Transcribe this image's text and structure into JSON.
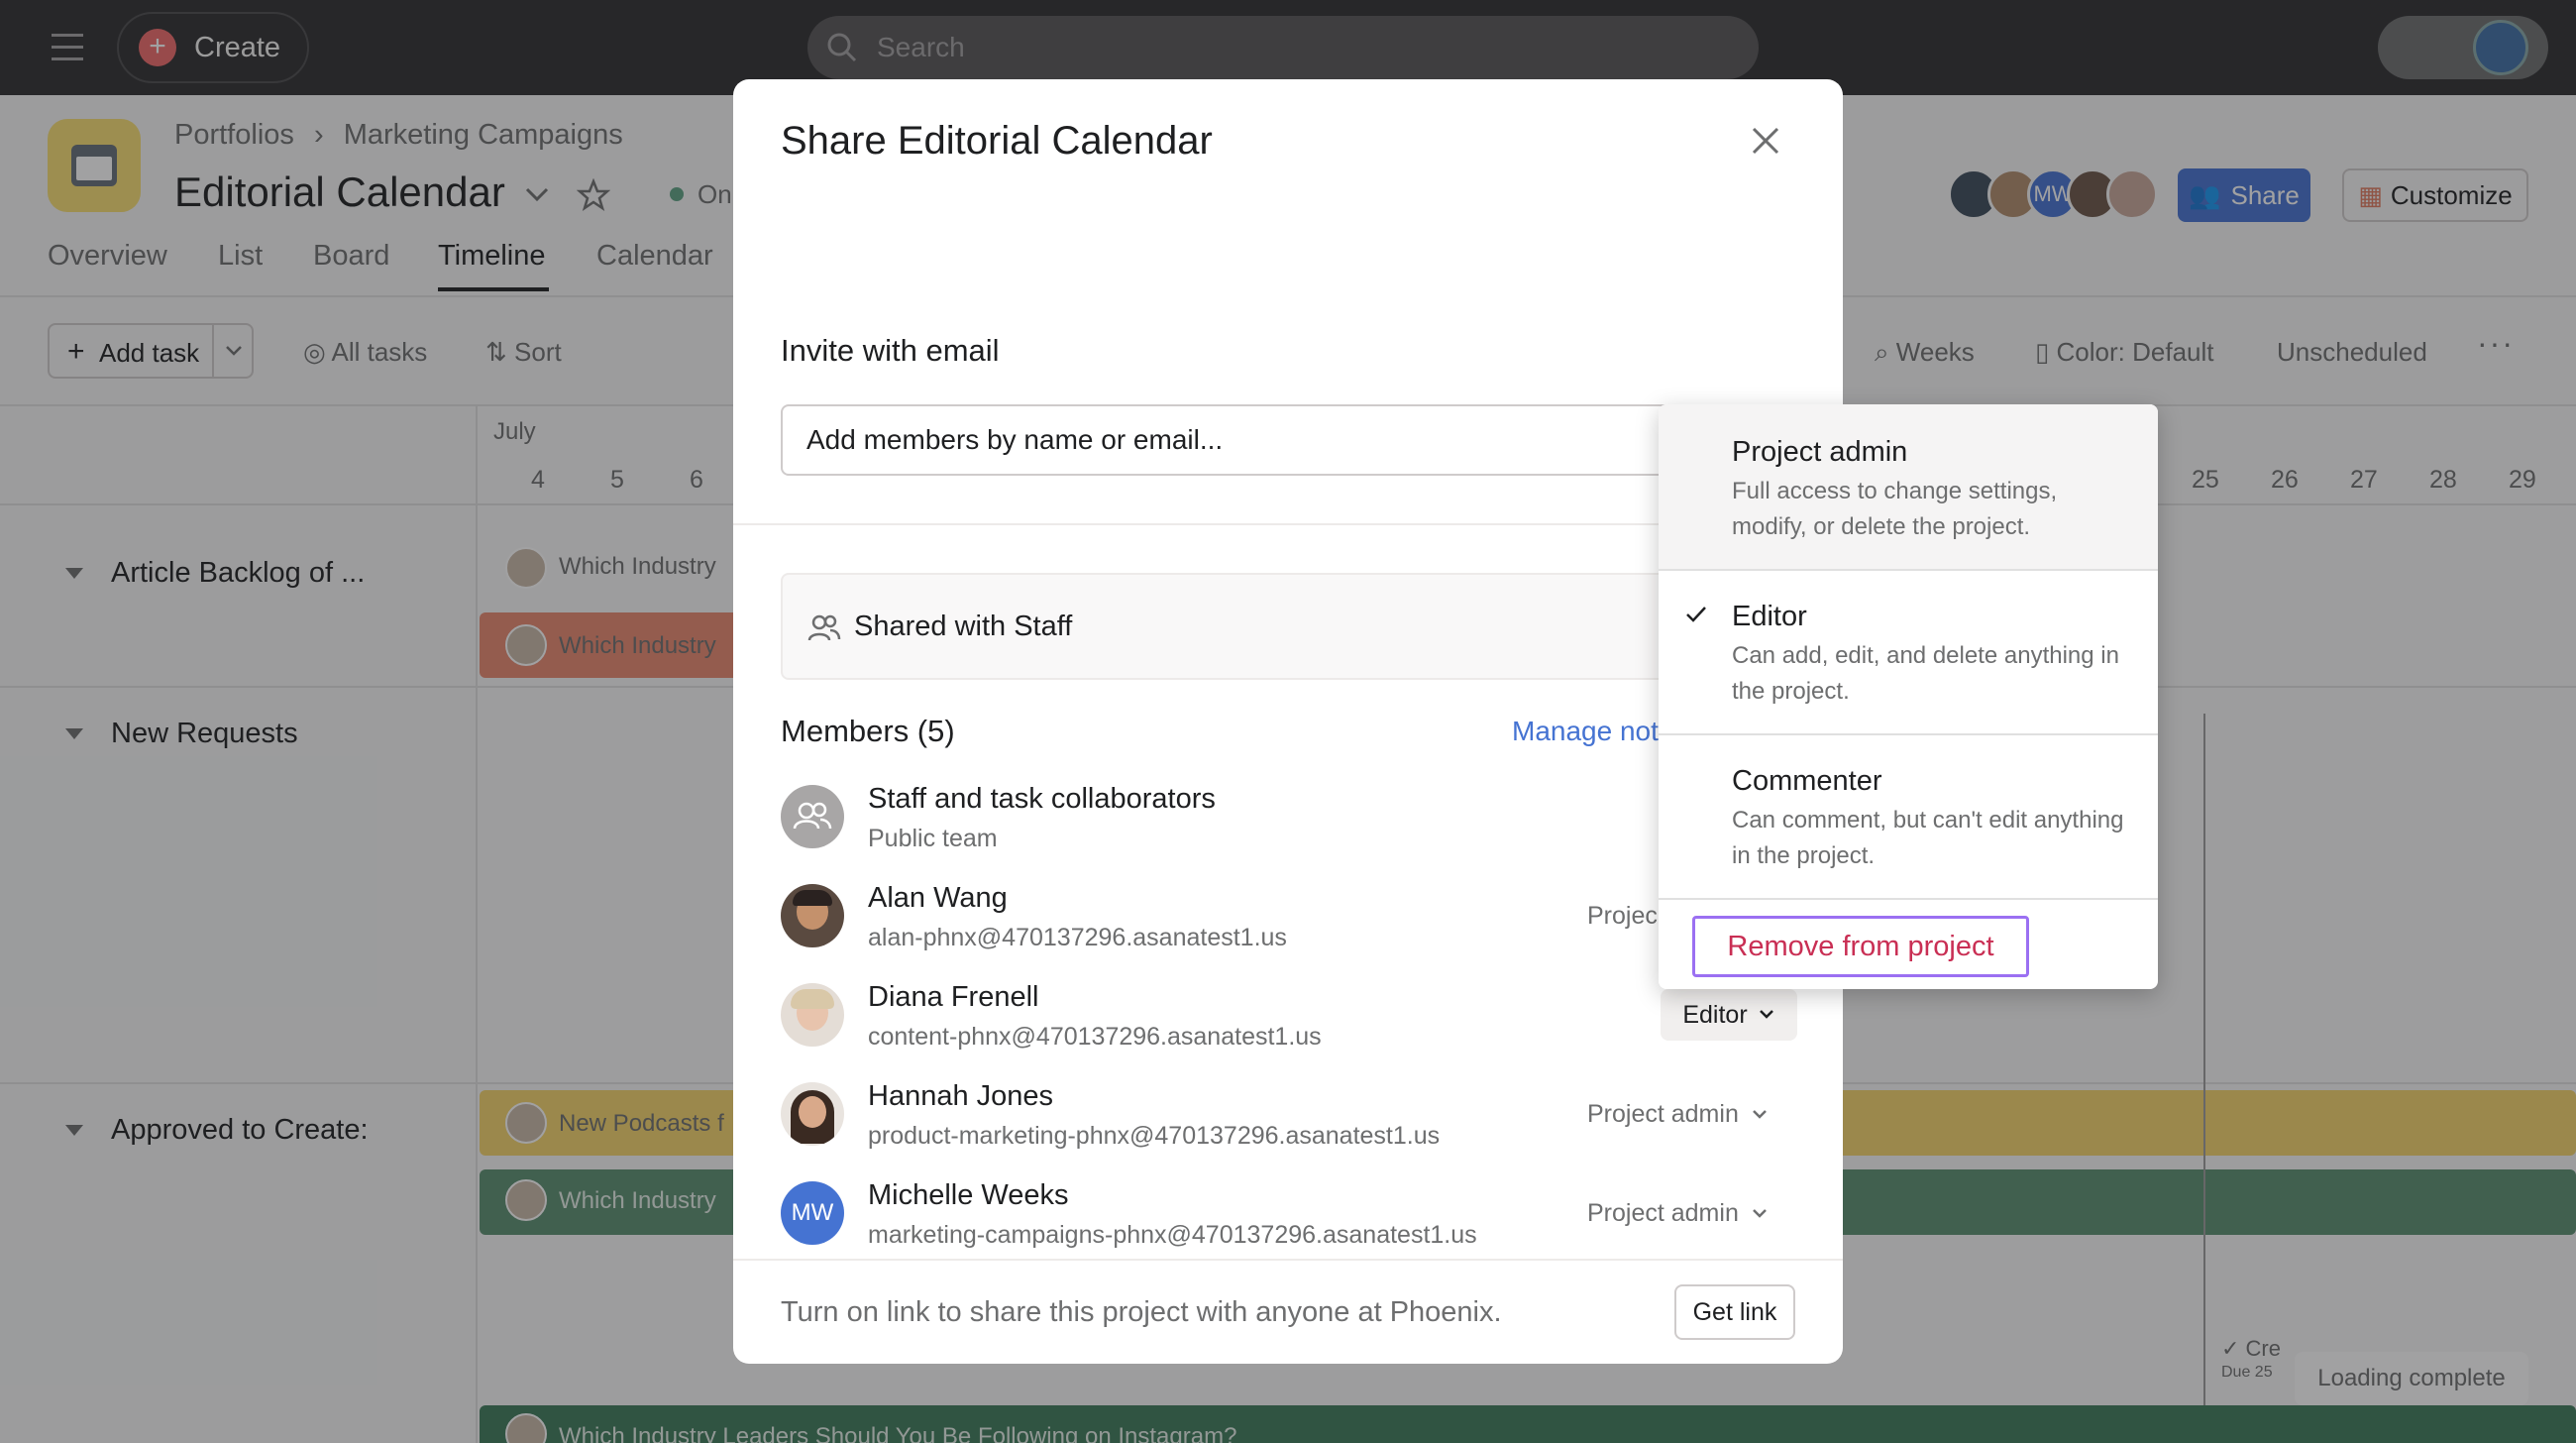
{
  "topbar": {
    "create_label": "Create",
    "search_placeholder": "Search"
  },
  "project": {
    "breadcrumb_parent": "Portfolios",
    "breadcrumb_child": "Marketing Campaigns",
    "title": "Editorial Calendar",
    "status": "On"
  },
  "tabs": [
    "Overview",
    "List",
    "Board",
    "Timeline",
    "Calendar"
  ],
  "active_tab": "Timeline",
  "header_actions": {
    "avatar_initials": "MW",
    "share_label": "Share",
    "customize_label": "Customize"
  },
  "toolbar": {
    "add_task_label": "Add task",
    "all_tasks_label": "All tasks",
    "sort_label": "Sort",
    "weeks_label": "Weeks",
    "color_label": "Color: Default",
    "unscheduled_label": "Unscheduled"
  },
  "timeline": {
    "month": "July",
    "days_left": [
      "4",
      "5",
      "6"
    ],
    "days_right": [
      "25",
      "26",
      "27",
      "28",
      "29"
    ],
    "sections": [
      {
        "title": "Article Backlog of ..."
      },
      {
        "title": "New Requests"
      },
      {
        "title": "Approved to Create:"
      }
    ],
    "bars": [
      {
        "label": "Which Industry"
      },
      {
        "label": "Which Industry"
      },
      {
        "label": "New Podcasts f"
      },
      {
        "label": "Which Industry"
      },
      {
        "label": "Which Industry Leaders Should You Be Following on Instagram?"
      }
    ],
    "milestone_label": "Cre",
    "milestone_due": "Due 25",
    "loading_label": "Loading complete",
    "colors": {
      "red_bar": "#e8896f",
      "yellow_bar": "#f4d56b",
      "green_bar": "#5b8f70",
      "dark_green_bar": "#3d7a5a"
    }
  },
  "modal": {
    "title": "Share Editorial Calendar",
    "invite_label": "Invite with email",
    "invite_placeholder": "Add members by name or email...",
    "shared_label": "Shared with Staff",
    "members_label": "Members (5)",
    "manage_link": "Manage not",
    "members": [
      {
        "name": "Staff and task collaborators",
        "sub": "Public team",
        "role": ""
      },
      {
        "name": "Alan Wang",
        "sub": "alan-phnx@470137296.asanatest1.us",
        "role": "Projec"
      },
      {
        "name": "Diana Frenell",
        "sub": "content-phnx@470137296.asanatest1.us",
        "role": "Editor"
      },
      {
        "name": "Hannah Jones",
        "sub": "product-marketing-phnx@470137296.asanatest1.us",
        "role": "Project admin"
      },
      {
        "name": "Michelle Weeks",
        "sub": "marketing-campaigns-phnx@470137296.asanatest1.us",
        "role": "Project admin",
        "initials": "MW"
      }
    ],
    "footer_text": "Turn on link to share this project with anyone at Phoenix.",
    "get_link_label": "Get link"
  },
  "role_dropdown": {
    "options": [
      {
        "title": "Project admin",
        "desc": "Full access to change settings, modify, or delete the project.",
        "selected": false,
        "highlighted": true
      },
      {
        "title": "Editor",
        "desc": "Can add, edit, and delete anything in the project.",
        "selected": true,
        "highlighted": false
      },
      {
        "title": "Commenter",
        "desc": "Can comment, but can't edit anything in the project.",
        "selected": false,
        "highlighted": false
      }
    ],
    "remove_label": "Remove from project",
    "remove_color": "#c92f54",
    "focus_ring_color": "#9b70f2"
  }
}
